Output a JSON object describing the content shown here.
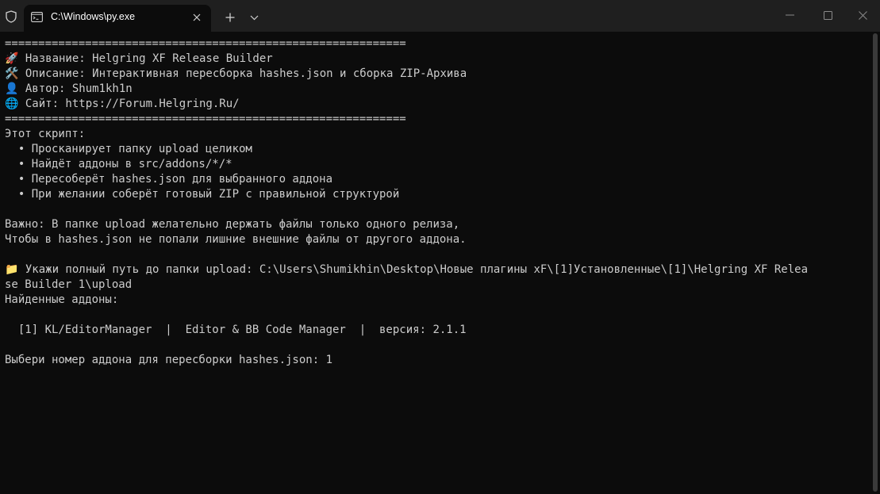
{
  "window": {
    "tab_title": "C:\\Windows\\py.exe",
    "new_tab_symbol": "+",
    "icons": [
      "shield-icon",
      "terminal-icon",
      "close-icon",
      "plus-icon",
      "chevron-down-icon",
      "minimize-icon",
      "maximize-icon",
      "close-icon"
    ]
  },
  "console": {
    "lines": [
      "============================================================",
      "🚀 Название: Helgring XF Release Builder",
      "🛠️ Описание: Интерактивная пересборка hashes.json и сборка ZIP-Архива",
      "👤 Автор: Shum1kh1n",
      "🌐 Сайт: https://Forum.Helgring.Ru/",
      "============================================================",
      "Этот скрипт:",
      "  • Просканирует папку upload целиком",
      "  • Найдёт аддоны в src/addons/*/*",
      "  • Пересоберёт hashes.json для выбранного аддона",
      "  • При желании соберёт готовый ZIP с правильной структурой",
      "",
      "Важно: В папке upload желательно держать файлы только одного релиза,",
      "Чтобы в hashes.json не попали лишние внешние файлы от другого аддона.",
      "",
      "📁 Укажи полный путь до папки upload: C:\\Users\\Shumikhin\\Desktop\\Новые плагины xF\\[1]Установленные\\[1]\\Helgring XF Relea",
      "se Builder 1\\upload",
      "Найденные аддоны:",
      "",
      "  [1] KL/EditorManager  |  Editor & BB Code Manager  |  версия: 2.1.1",
      "",
      "Выбери номер аддона для пересборки hashes.json: 1"
    ]
  },
  "colors": {
    "background": "#0c0c0c",
    "titlebar": "#1f1f1f",
    "text": "#cccccc"
  }
}
